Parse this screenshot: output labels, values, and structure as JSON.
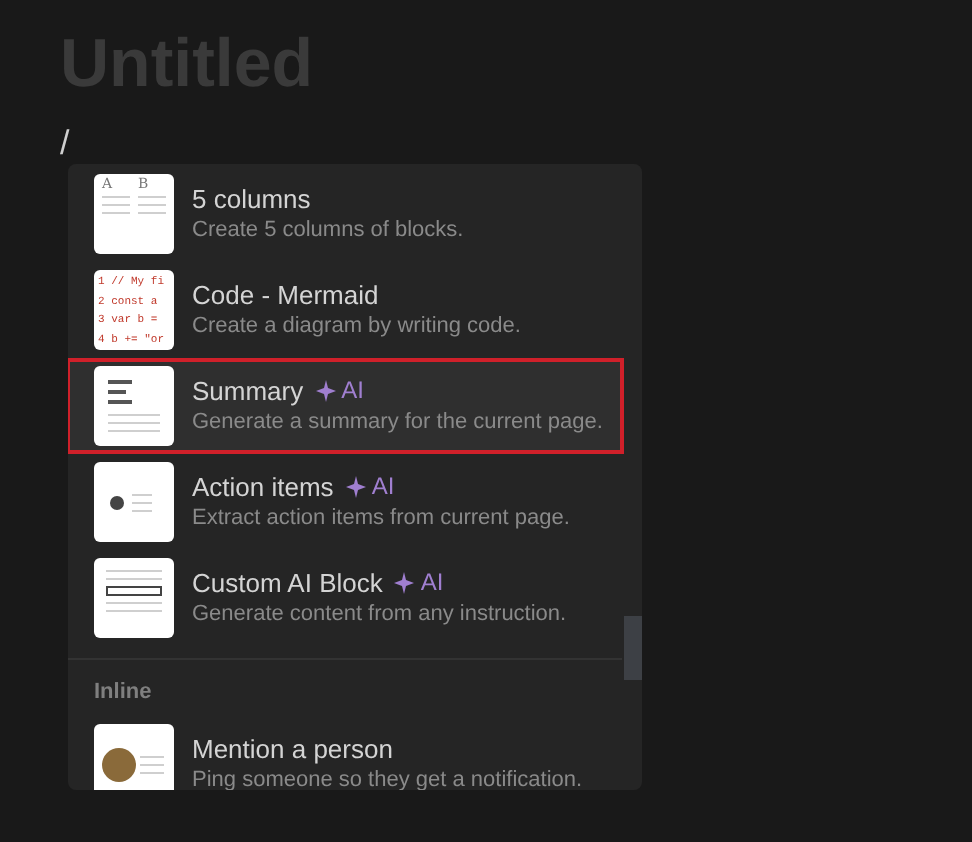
{
  "page": {
    "title": "Untitled",
    "input": "/"
  },
  "menu": {
    "sections": [
      {
        "items": [
          {
            "kind": "columns",
            "title": "5 columns",
            "description": "Create 5 columns of blocks.",
            "thumbnail_text": [
              "A",
              "B"
            ],
            "selected": false
          },
          {
            "kind": "code",
            "title": "Code - Mermaid",
            "description": "Create a diagram by writing code.",
            "thumbnail_text": [
              "1 // My fi",
              "2 const a",
              "3 var b =",
              "4 b += \"or"
            ],
            "selected": false
          },
          {
            "kind": "summary",
            "title": "Summary",
            "badge": "AI",
            "description": "Generate a summary for the current page.",
            "selected": true
          },
          {
            "kind": "action",
            "title": "Action items",
            "badge": "AI",
            "description": "Extract action items from current page.",
            "selected": false
          },
          {
            "kind": "custom",
            "title": "Custom AI Block",
            "badge": "AI",
            "description": "Generate content from any instruction.",
            "selected": false
          }
        ]
      },
      {
        "heading": "Inline",
        "items": [
          {
            "kind": "mention",
            "title": "Mention a person",
            "description": "Ping someone so they get a notification.",
            "selected": false
          }
        ]
      }
    ]
  }
}
